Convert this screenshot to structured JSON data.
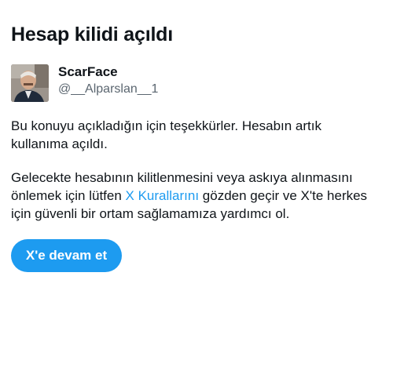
{
  "page": {
    "title": "Hesap kilidi açıldı"
  },
  "account": {
    "display_name": "ScarFace",
    "handle": "@__Alparslan__1",
    "avatar_icon": "profile-photo"
  },
  "message": {
    "paragraph1": "Bu konuyu açıkladığın için teşekkürler. Hesabın artık kullanıma açıldı.",
    "paragraph2_before": "Gelecekte hesabının kilitlenmesini veya askıya alınmasını önlemek için lütfen ",
    "paragraph2_link": "X Kurallarını",
    "paragraph2_after": " gözden geçir ve X'te herkes için güvenli bir ortam sağlamamıza yardımcı ol."
  },
  "actions": {
    "continue_label": "X'e devam et"
  },
  "colors": {
    "accent": "#1d9bf0",
    "text": "#0f1419",
    "secondary_text": "#5b6670"
  }
}
